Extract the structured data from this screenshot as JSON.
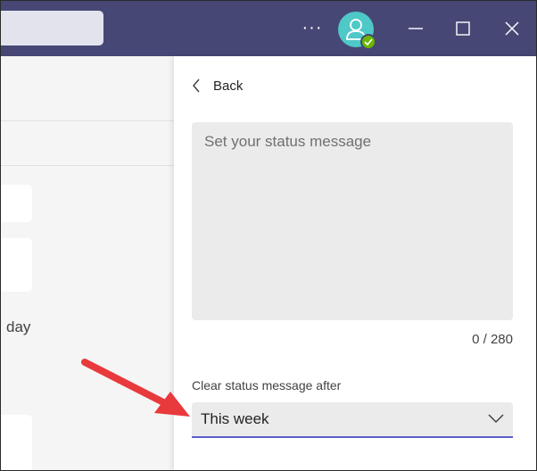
{
  "titlebar": {
    "more_label": "···",
    "icons": [
      "more-options-icon",
      "avatar-person-icon",
      "available-check-icon",
      "minimize-icon",
      "maximize-icon",
      "close-icon"
    ],
    "background": "#464775",
    "presence_color": "#6bb700",
    "avatar_color": "#4fc8c8"
  },
  "left": {
    "partial_text": "day"
  },
  "panel": {
    "back_label": "Back",
    "status_placeholder": "Set your status message",
    "counter": "0 / 280",
    "clear_label": "Clear status message after",
    "clear_value": "This week",
    "accent": "#5b5fc7"
  },
  "annotation": {
    "arrow_color": "#e8393c"
  }
}
